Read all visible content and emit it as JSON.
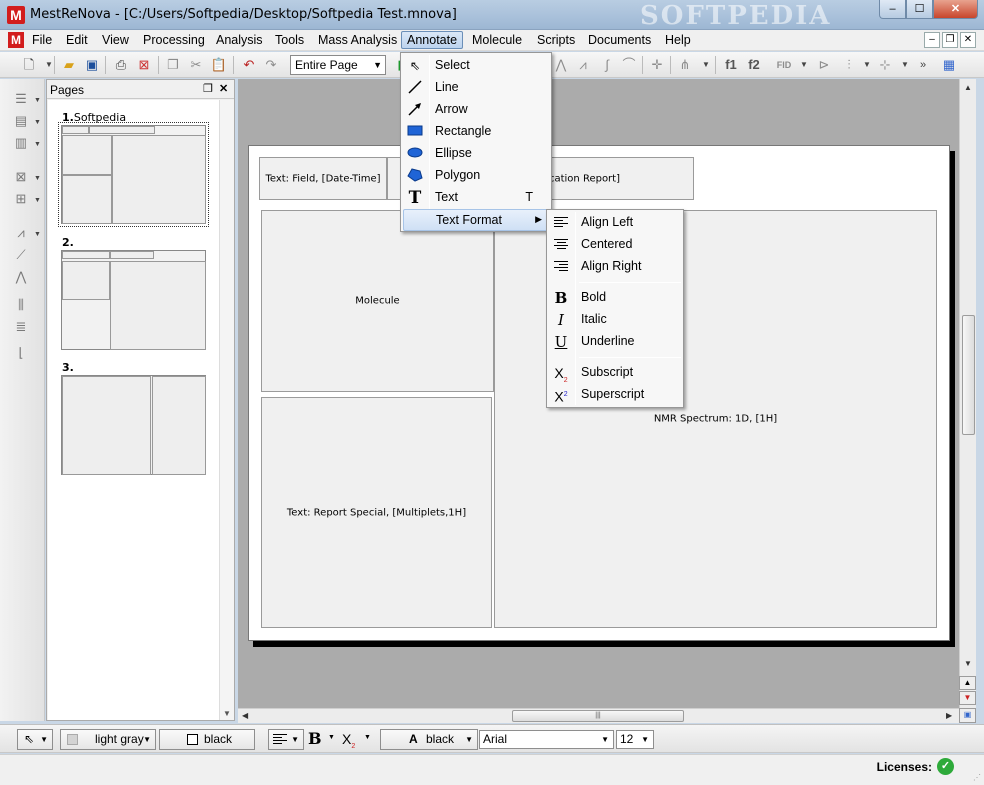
{
  "window": {
    "title": "MestReNova - [C:/Users/Softpedia/Desktop/Softpedia Test.mnova]",
    "watermark": "SOFTPEDIA",
    "app_icon_glyph": "M",
    "btn_minimize": "–",
    "btn_maximize": "☐",
    "btn_close": "✕"
  },
  "menubar": {
    "items": [
      "File",
      "Edit",
      "View",
      "Processing",
      "Analysis",
      "Tools",
      "Mass Analysis",
      "Annotate",
      "Molecule",
      "Scripts",
      "Documents",
      "Help"
    ],
    "active": "Annotate",
    "mdi_minimize": "–",
    "mdi_restore": "❐",
    "mdi_close": "✕"
  },
  "toolbar": {
    "zoom_value": "Entire Page",
    "icons": [
      "new-document-icon",
      "open-folder-icon",
      "save-icon",
      "print-icon",
      "export-pdf-icon",
      "copy-icon",
      "cut-icon",
      "paste-icon",
      "undo-icon",
      "redo-icon",
      "f1-button",
      "f2-button",
      "fid-button"
    ],
    "f1_label": "f1",
    "f2_label": "f2",
    "fid_label": "FID"
  },
  "pages_panel": {
    "title": "Pages",
    "pages": [
      {
        "number": "1.",
        "name": "Softpedia"
      },
      {
        "number": "2.",
        "name": ""
      },
      {
        "number": "3.",
        "name": ""
      }
    ]
  },
  "document": {
    "objects": {
      "text_field": "Text: Field, [Date-Time]",
      "report_title": "ification Report]",
      "molecule": "Molecule",
      "nmr_spectrum": "NMR Spectrum: 1D, [1H]",
      "report_special": "Text: Report Special, [Multiplets,1H]"
    }
  },
  "annotate_menu": {
    "items": [
      {
        "label": "Select",
        "icon": "select-arrow-icon",
        "shortcut": ""
      },
      {
        "label": "Line",
        "icon": "line-icon",
        "shortcut": ""
      },
      {
        "label": "Arrow",
        "icon": "arrow-icon",
        "shortcut": ""
      },
      {
        "label": "Rectangle",
        "icon": "rectangle-icon",
        "shortcut": ""
      },
      {
        "label": "Ellipse",
        "icon": "ellipse-icon",
        "shortcut": ""
      },
      {
        "label": "Polygon",
        "icon": "polygon-icon",
        "shortcut": ""
      },
      {
        "label": "Text",
        "icon": "text-icon",
        "shortcut": "T"
      },
      {
        "label": "Text Format",
        "icon": "",
        "shortcut": ""
      }
    ],
    "highlighted": "Text Format"
  },
  "text_format_menu": {
    "items": [
      {
        "label": "Align Left",
        "icon": "align-left-icon"
      },
      {
        "label": "Centered",
        "icon": "align-center-icon"
      },
      {
        "label": "Align Right",
        "icon": "align-right-icon"
      },
      {
        "label": "Bold",
        "icon": "bold-icon"
      },
      {
        "label": "Italic",
        "icon": "italic-icon"
      },
      {
        "label": "Underline",
        "icon": "underline-icon"
      },
      {
        "label": "Subscript",
        "icon": "subscript-icon"
      },
      {
        "label": "Superscript",
        "icon": "superscript-icon"
      }
    ]
  },
  "format_bar": {
    "fill_color": "light gray",
    "line_color": "black",
    "text_color": "black",
    "font": "Arial",
    "font_size": "12"
  },
  "status": {
    "licenses_label": "Licenses:"
  },
  "colors": {
    "accent": "#6b8fb8",
    "ok_green": "#2eaa3a",
    "brand_red": "#d21d1d"
  }
}
